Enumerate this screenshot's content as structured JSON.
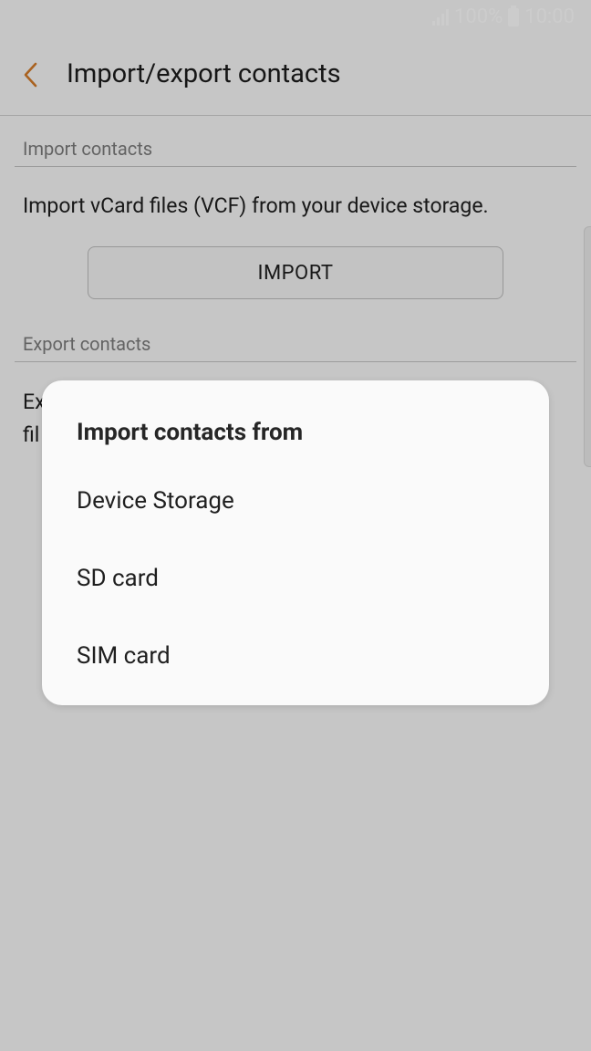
{
  "status_bar": {
    "battery": "100%",
    "time": "10:00"
  },
  "header": {
    "title": "Import/export contacts",
    "accent_color": "#d47b28"
  },
  "import_section": {
    "header": "Import contacts",
    "description": "Import vCard files (VCF) from your device storage.",
    "button_label": "IMPORT"
  },
  "export_section": {
    "header": "Export contacts",
    "description_line1": "Ex",
    "description_line2": "fil"
  },
  "dialog": {
    "title": "Import contacts from",
    "options": [
      {
        "label": "Device Storage"
      },
      {
        "label": "SD card"
      },
      {
        "label": "SIM card"
      }
    ]
  }
}
